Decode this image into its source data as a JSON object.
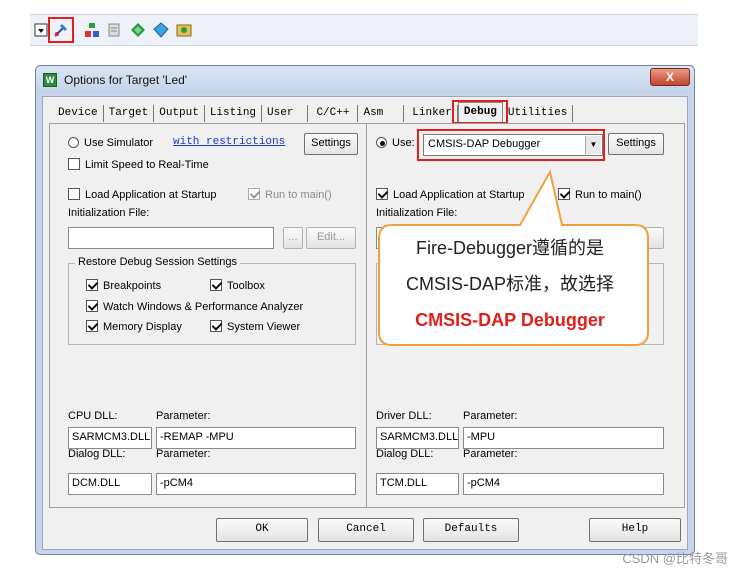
{
  "window": {
    "title": "Options for Target 'Led'",
    "close_glyph": "X",
    "icon_glyph": "W"
  },
  "tabs": [
    "Device",
    "Target",
    "Output",
    "Listing",
    "User",
    "C/C++",
    "Asm",
    "Linker",
    "Debug",
    "Utilities"
  ],
  "active_tab": "Debug",
  "left": {
    "use_simulator_label": "Use Simulator",
    "restrictions_link": "with restrictions",
    "settings_label": "Settings",
    "limit_speed_label": "Limit Speed to Real-Time",
    "load_app_label": "Load Application at Startup",
    "run_to_main_label": "Run to main()",
    "init_file_label": "Initialization File:",
    "init_file_value": "",
    "browse_label": "...",
    "edit_label": "Edit...",
    "restore_group_title": "Restore Debug Session Settings",
    "breakpoints_label": "Breakpoints",
    "toolbox_label": "Toolbox",
    "watch_windows_label": "Watch Windows & Performance Analyzer",
    "memory_display_label": "Memory Display",
    "system_viewer_label": "System Viewer",
    "cpu_dll_label": "CPU DLL:",
    "cpu_param_label": "Parameter:",
    "cpu_dll_value": "SARMCM3.DLL",
    "cpu_param_value": "-REMAP -MPU",
    "dialog_dll_label": "Dialog DLL:",
    "dialog_param_label": "Parameter:",
    "dialog_dll_value": "DCM.DLL",
    "dialog_param_value": "-pCM4"
  },
  "right": {
    "use_label": "Use:",
    "debugger_selected": "CMSIS-DAP Debugger",
    "settings_label": "Settings",
    "load_app_label": "Load Application at Startup",
    "run_to_main_label": "Run to main()",
    "init_file_label": "Initialization File:",
    "driver_dll_label": "Driver DLL:",
    "driver_param_label": "Parameter:",
    "driver_dll_value": "SARMCM3.DLL",
    "driver_param_value": "-MPU",
    "dialog_dll_label": "Dialog DLL:",
    "dialog_param_label": "Parameter:",
    "dialog_dll_value": "TCM.DLL",
    "dialog_param_value": "-pCM4"
  },
  "callout": {
    "line1": "Fire-Debugger遵循的是",
    "line2": "CMSIS-DAP标准，故选择",
    "line3": "CMSIS-DAP Debugger"
  },
  "bottom_buttons": {
    "ok": "OK",
    "cancel": "Cancel",
    "defaults": "Defaults",
    "help": "Help"
  },
  "watermark": "CSDN @比特冬哥",
  "colors": {
    "highlight": "#e0201b",
    "callout_border": "#f0a040",
    "link": "#1d38c9"
  }
}
